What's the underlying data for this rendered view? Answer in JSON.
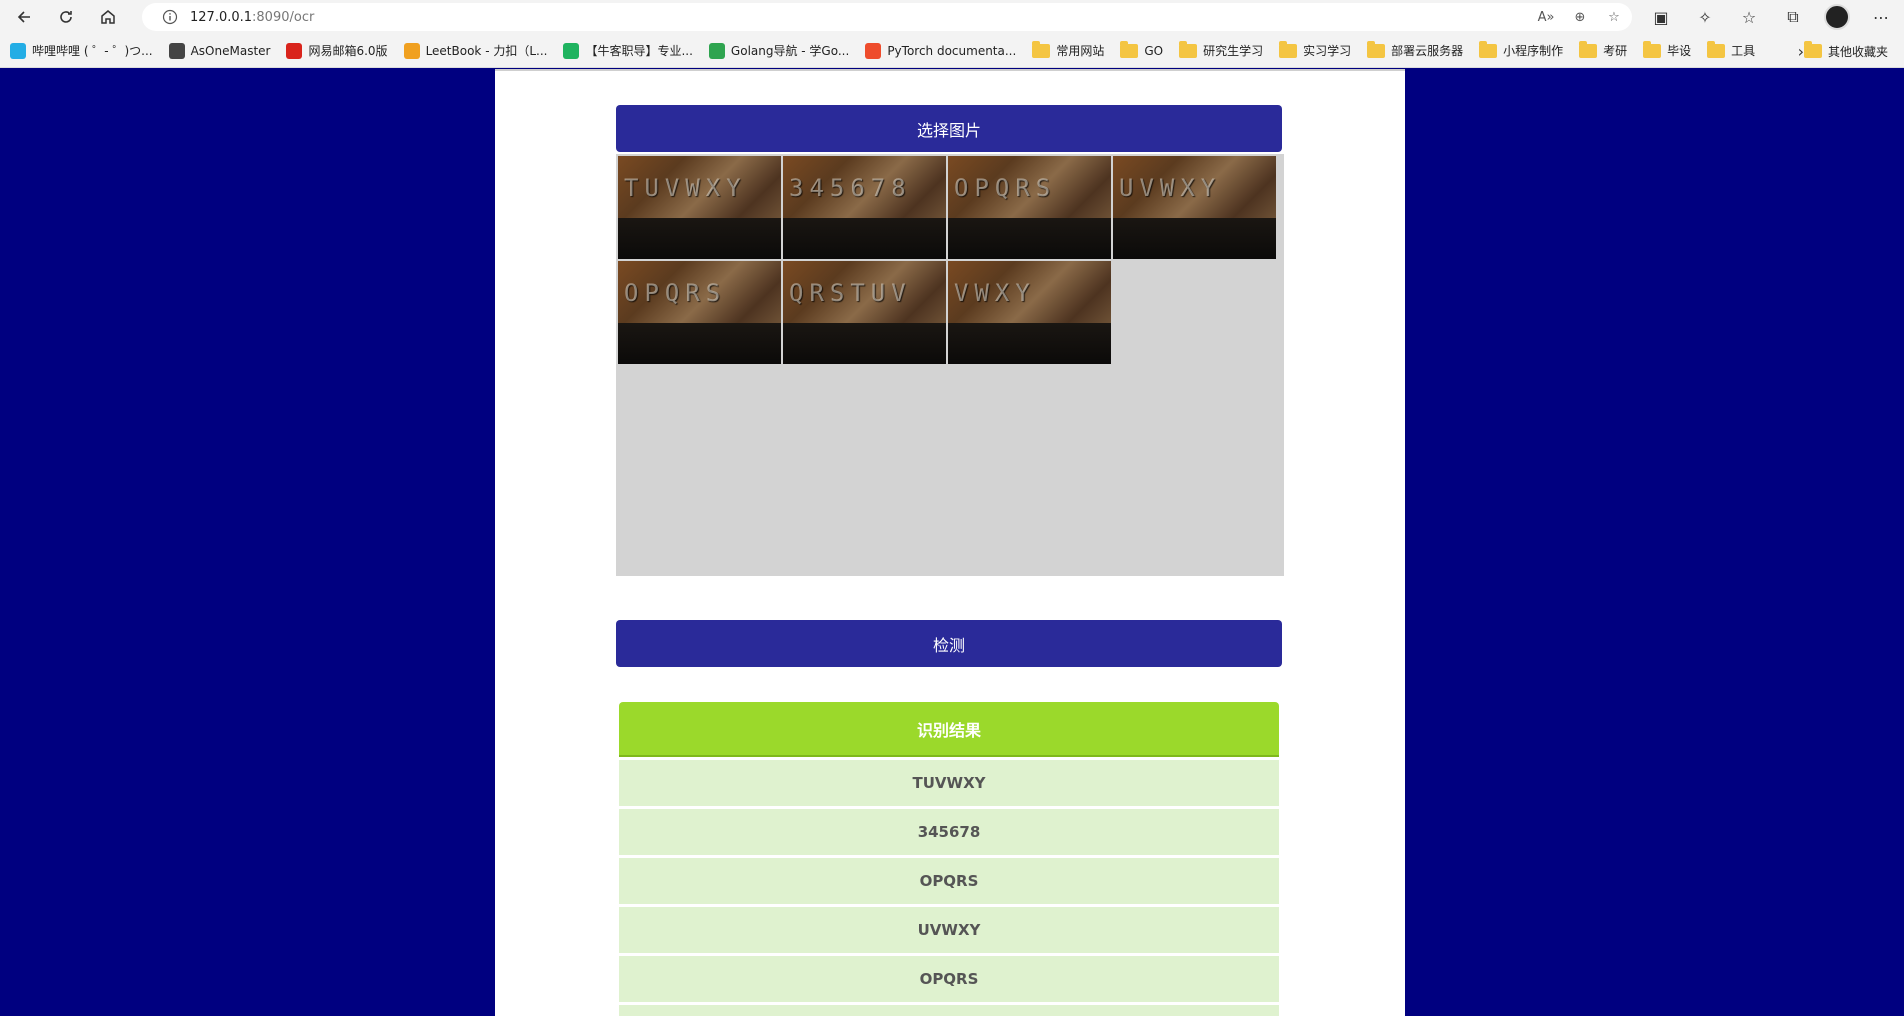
{
  "browser": {
    "url_host": "127.0.0.1",
    "url_rest": ":8090/ocr"
  },
  "bookmarks": [
    {
      "label": "哔哩哔哩 ( ゜- ゜)つ...",
      "color": "#23ade5"
    },
    {
      "label": "AsOneMaster",
      "color": "#444444"
    },
    {
      "label": "网易邮箱6.0版",
      "color": "#d9241c"
    },
    {
      "label": "LeetBook - 力扣（L...",
      "color": "#f0a020"
    },
    {
      "label": "【牛客职导】专业...",
      "color": "#1fb35f"
    },
    {
      "label": "Golang导航 - 学Go...",
      "color": "#2ea44f"
    },
    {
      "label": "PyTorch documenta...",
      "color": "#ee4c2c"
    },
    {
      "label": "常用网站",
      "folder": true
    },
    {
      "label": "GO",
      "folder": true
    },
    {
      "label": "研究生学习",
      "folder": true
    },
    {
      "label": "实习学习",
      "folder": true
    },
    {
      "label": "部署云服务器",
      "folder": true
    },
    {
      "label": "小程序制作",
      "folder": true
    },
    {
      "label": "考研",
      "folder": true
    },
    {
      "label": "毕设",
      "folder": true
    },
    {
      "label": "工具",
      "folder": true
    }
  ],
  "bookmarks_other": "其他收藏夹",
  "page": {
    "select_button": "选择图片",
    "detect_button": "检测",
    "thumbnails": [
      "TUVWXY",
      "345678",
      "OPQRS",
      "UVWXY",
      "OPQRS",
      "QRSTUV",
      "VWXY"
    ],
    "results_title": "识别结果",
    "results": [
      "TUVWXY",
      "345678",
      "OPQRS",
      "UVWXY",
      "OPQRS"
    ]
  },
  "colors": {
    "page_bg": "#000080",
    "button": "#2a2a99",
    "results_header": "#9bd92b",
    "results_row": "#dff2cf",
    "gallery_bg": "#d3d3d3"
  }
}
